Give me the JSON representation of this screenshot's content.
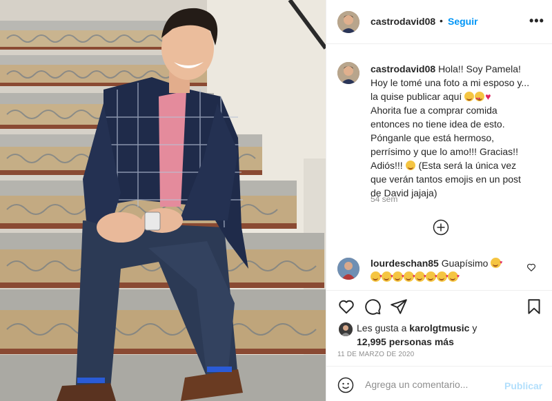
{
  "post": {
    "username": "castrodavid08",
    "follow_label": "Seguir",
    "dot": "•",
    "more_label": "•••"
  },
  "caption": {
    "username": "castrodavid08",
    "lines": [
      "Hola!! Soy Pamela!",
      "Hoy le tomé una foto a mi esposo y...",
      "la quise publicar aquí",
      "Ahorita fue a comprar comida",
      "entonces no tiene idea de esto.",
      "Pónganle que está hermoso,",
      "perrísimo y que lo amo!!! Gracias!!",
      "Adiós!!!",
      "(Esta será la única vez",
      "que verán tantos emojis en un post",
      "de David jajaja)"
    ],
    "time": "54 sem"
  },
  "comment": {
    "username": "lourdeschan85",
    "text": "Guapísimo",
    "emoji_count": 8
  },
  "likes": {
    "prefix": "Les gusta a",
    "user": "karolgtmusic",
    "conj": "y",
    "count": "12,995 personas más"
  },
  "date": "11 DE MARZO DE 2020",
  "comment_box": {
    "placeholder": "Agrega un comentario...",
    "publish_label": "Publicar"
  },
  "icons": {
    "more": "more-horizontal-icon",
    "load_more": "plus-circle-icon",
    "like": "heart-outline-icon",
    "comment": "comment-bubble-icon",
    "share": "paper-plane-icon",
    "save": "bookmark-icon",
    "emoji": "smiley-icon"
  },
  "colors": {
    "link": "#0095f6",
    "publish_disabled": "#b2dffc",
    "muted": "#8e8e8e",
    "text": "#262626"
  }
}
